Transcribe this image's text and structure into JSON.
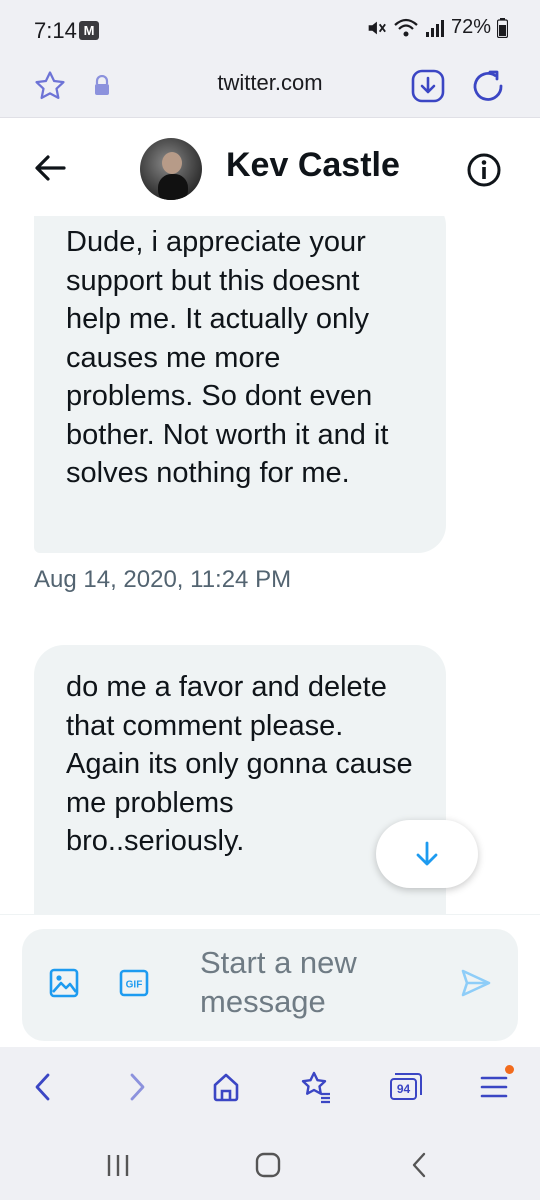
{
  "status_bar": {
    "time": "7:14",
    "notification_badge": "M",
    "battery_percent": "72%"
  },
  "browser": {
    "url": "twitter.com",
    "tab_count": "94",
    "accent_color": "#3b46c4"
  },
  "conversation": {
    "contact_name": "Kev Castle"
  },
  "messages": [
    {
      "text": "Dude, i appreciate your support but this doesnt help me. It actually only causes me more problems. So dont even bother. Not worth it and it solves nothing for me.",
      "timestamp": "Aug 14, 2020, 11:24 PM"
    },
    {
      "text": "do me a favor and delete that comment please. Again its only gonna cause me problems bro..seriously."
    }
  ],
  "composer": {
    "placeholder": "Start a new message",
    "gif_label": "GIF"
  },
  "colors": {
    "twitter_blue": "#1d9bf0",
    "bubble_bg": "#eff3f4",
    "timestamp_gray": "#536471"
  }
}
